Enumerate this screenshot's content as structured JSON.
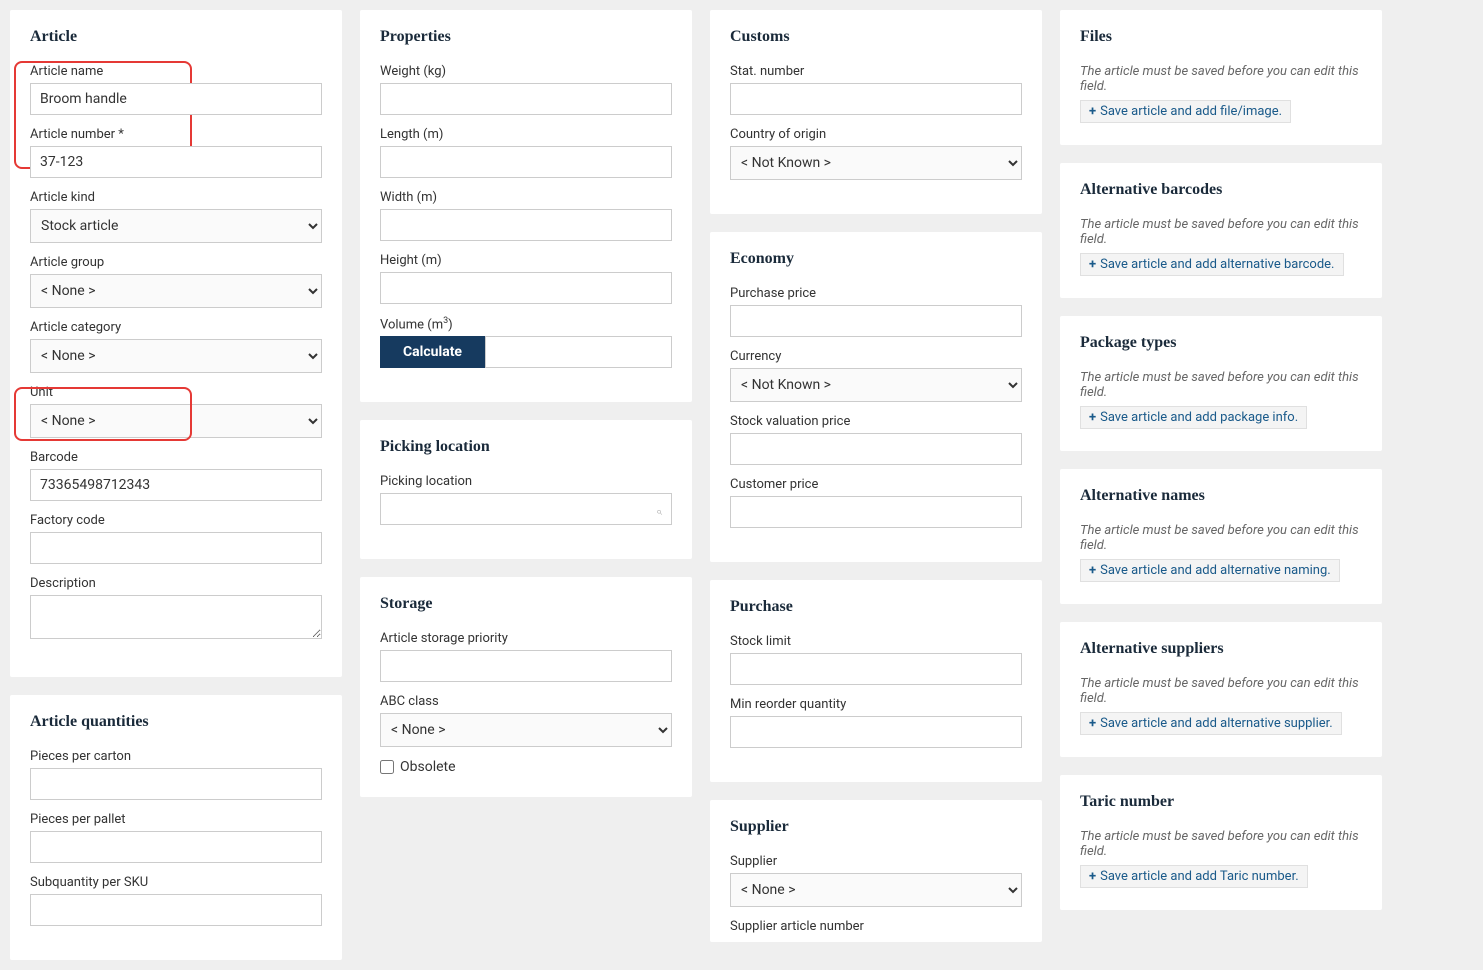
{
  "article": {
    "title": "Article",
    "name_label": "Article name",
    "name_value": "Broom handle",
    "number_label": "Article number *",
    "number_value": "37-123",
    "kind_label": "Article kind",
    "kind_value": "Stock article",
    "group_label": "Article group",
    "group_value": "< None >",
    "category_label": "Article category",
    "category_value": "< None >",
    "unit_label": "Unit",
    "unit_value": "< None >",
    "barcode_label": "Barcode",
    "barcode_value": "73365498712343",
    "factory_label": "Factory code",
    "factory_value": "",
    "description_label": "Description",
    "description_value": ""
  },
  "quantities": {
    "title": "Article quantities",
    "carton_label": "Pieces per carton",
    "pallet_label": "Pieces per pallet",
    "sub_label": "Subquantity per SKU"
  },
  "properties": {
    "title": "Properties",
    "weight_label": "Weight (kg)",
    "length_label": "Length (m)",
    "width_label": "Width (m)",
    "height_label": "Height (m)",
    "volume_label": "Volume (m",
    "volume_sup": "3",
    "volume_close": ")",
    "calculate": "Calculate"
  },
  "picking": {
    "title": "Picking location",
    "location_label": "Picking location"
  },
  "storage": {
    "title": "Storage",
    "priority_label": "Article storage priority",
    "abc_label": "ABC class",
    "abc_value": "< None >",
    "obsolete_label": "Obsolete"
  },
  "customs": {
    "title": "Customs",
    "stat_label": "Stat. number",
    "origin_label": "Country of origin",
    "origin_value": "< Not Known >"
  },
  "economy": {
    "title": "Economy",
    "purchase_label": "Purchase price",
    "currency_label": "Currency",
    "currency_value": "< Not Known >",
    "valuation_label": "Stock valuation price",
    "customer_label": "Customer price"
  },
  "purchase": {
    "title": "Purchase",
    "stock_label": "Stock limit",
    "reorder_label": "Min reorder quantity"
  },
  "supplier": {
    "title": "Supplier",
    "supplier_label": "Supplier",
    "supplier_value": "< None >",
    "artnum_label": "Supplier article number"
  },
  "side": {
    "save_note": "The article must be saved before you can edit this field.",
    "files_title": "Files",
    "files_btn": "Save article and add file/image.",
    "altbar_title": "Alternative barcodes",
    "altbar_btn": "Save article and add alternative barcode.",
    "pkg_title": "Package types",
    "pkg_btn": "Save article and add package info.",
    "altnames_title": "Alternative names",
    "altnames_btn": "Save article and add alternative naming.",
    "altsup_title": "Alternative suppliers",
    "altsup_btn": "Save article and add alternative supplier.",
    "taric_title": "Taric number",
    "taric_btn": "Save article and add Taric number."
  }
}
